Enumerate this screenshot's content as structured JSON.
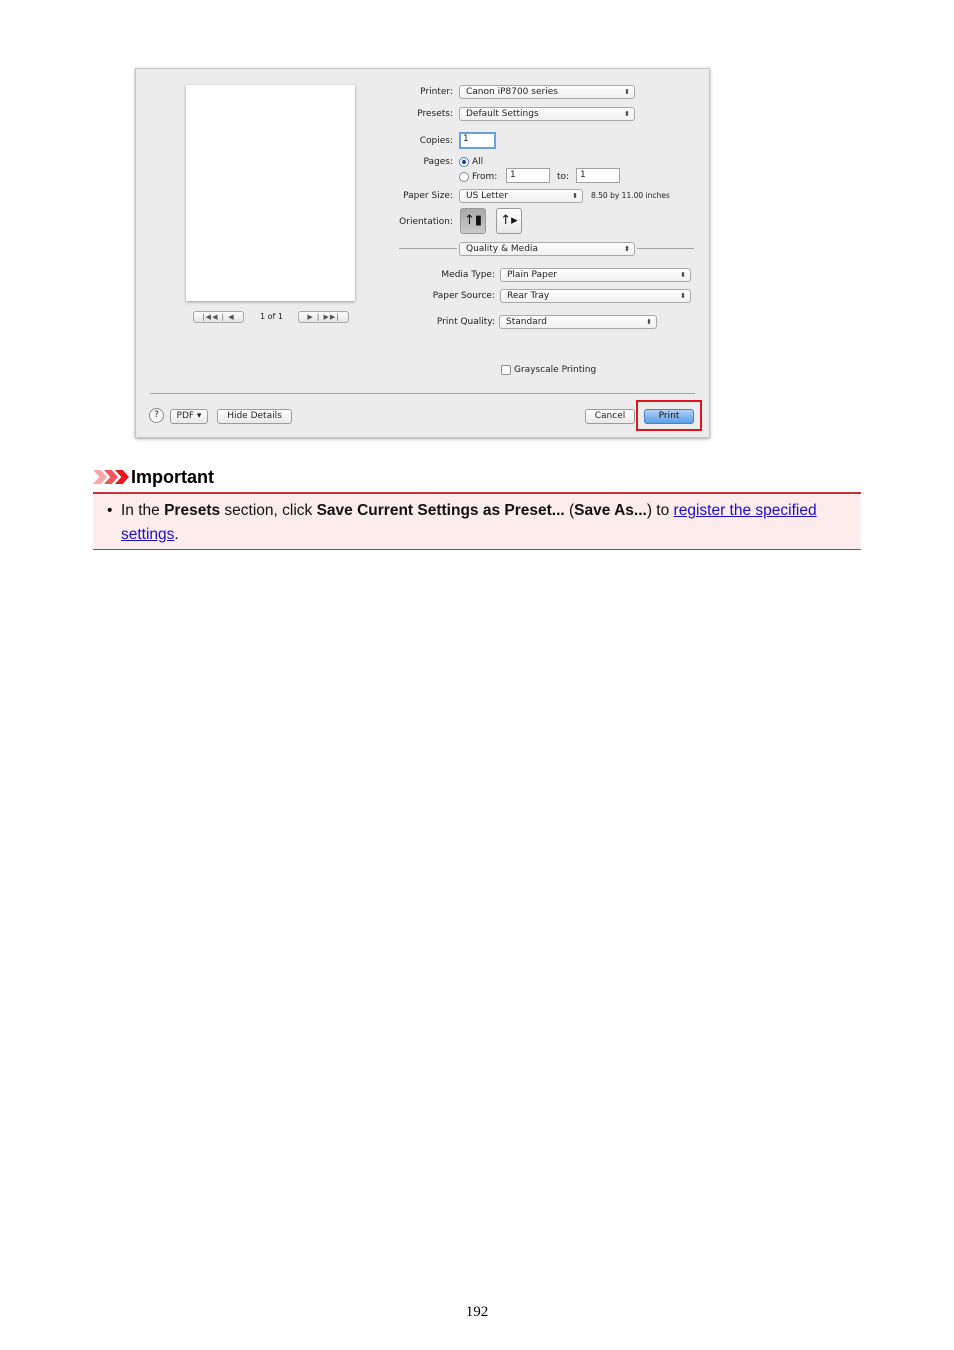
{
  "dialog": {
    "preview": {
      "first_button_glyph": "|◀◀ | ◀",
      "last_button_glyph": "▶ | ▶▶|",
      "page_counter": "1 of 1"
    },
    "printer": {
      "label": "Printer:",
      "value": "Canon iP8700 series"
    },
    "presets": {
      "label": "Presets:",
      "value": "Default Settings"
    },
    "copies": {
      "label": "Copies:",
      "value": "1"
    },
    "pages": {
      "label": "Pages:",
      "all_label": "All",
      "all_selected": true,
      "from_label": "From:",
      "from_value": "1",
      "to_label": "to:",
      "to_value": "1"
    },
    "paper_size": {
      "label": "Paper Size:",
      "value": "US Letter",
      "dimensions": "8.50 by 11.00 inches"
    },
    "orientation": {
      "label": "Orientation:",
      "selected": "portrait",
      "options": [
        "portrait",
        "landscape"
      ]
    },
    "panel_selector": {
      "value": "Quality & Media"
    },
    "media_type": {
      "label": "Media Type:",
      "value": "Plain Paper"
    },
    "paper_source": {
      "label": "Paper Source:",
      "value": "Rear Tray"
    },
    "print_quality": {
      "label": "Print Quality:",
      "value": "Standard"
    },
    "grayscale": {
      "label": "Grayscale Printing",
      "checked": false
    },
    "footer": {
      "help_glyph": "?",
      "pdf_label": "PDF ▾",
      "hide_details_label": "Hide Details",
      "cancel_label": "Cancel",
      "print_label": "Print"
    },
    "popup_arrows": "⬍",
    "highlight_color": "#e0141e"
  },
  "important": {
    "title": "Important",
    "bullet": "•",
    "text_1": "In the ",
    "bold_1": "Presets",
    "text_2": " section, click ",
    "bold_2": "Save Current Settings as Preset...",
    "text_3": " (",
    "bold_3": "Save As...",
    "text_4": ") to ",
    "link_line1": "register the specified",
    "link_line2": "settings",
    "text_5": ".",
    "accent_color": "#c8323a",
    "background_color": "#fdecec"
  },
  "page_number": "192"
}
